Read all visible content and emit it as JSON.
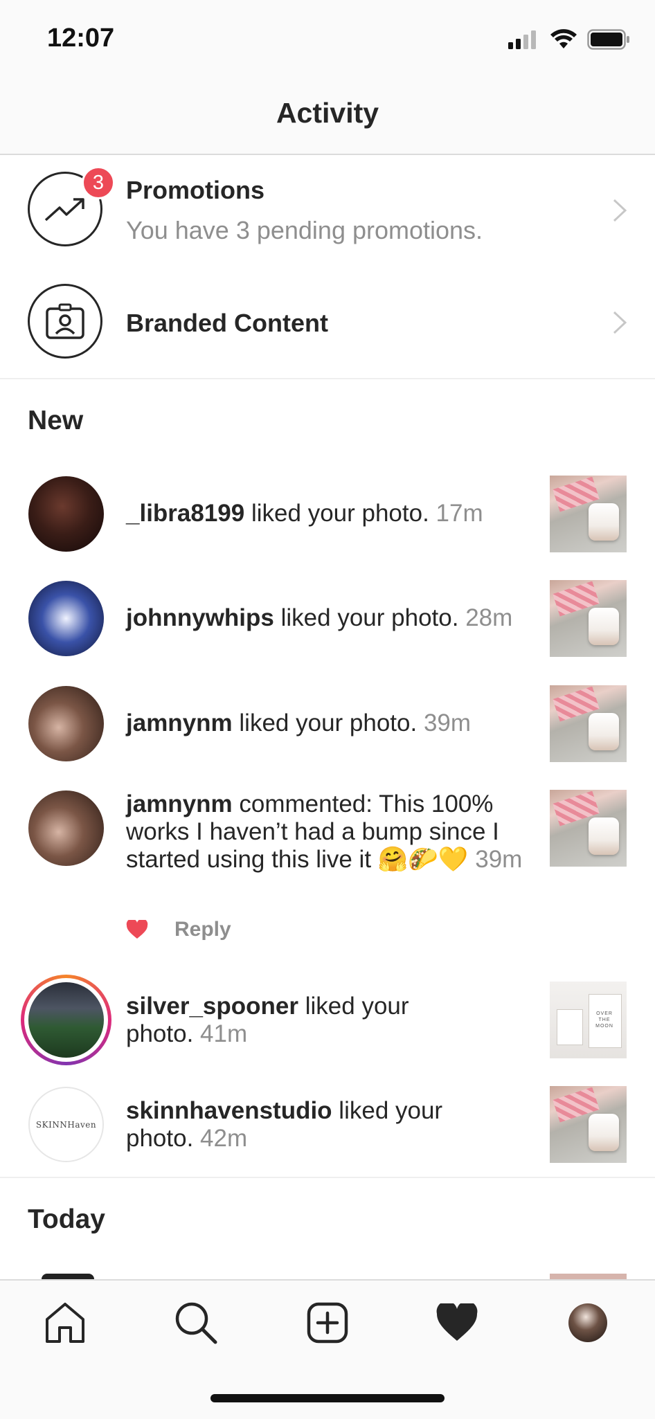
{
  "status_bar": {
    "time": "12:07",
    "icons": [
      "signal-icon",
      "wifi-icon",
      "battery-icon"
    ]
  },
  "header": {
    "title": "Activity"
  },
  "promotions": {
    "title": "Promotions",
    "subtitle": "You have 3 pending promotions.",
    "badge": "3"
  },
  "branded_content": {
    "title": "Branded Content"
  },
  "sections": {
    "new": "New",
    "today": "Today"
  },
  "activity": [
    {
      "user": "_libra8199",
      "text": "liked your photo.",
      "time": "17m"
    },
    {
      "user": "johnnywhips",
      "text": "liked your photo.",
      "time": "28m"
    },
    {
      "user": "jamnynm",
      "text": "liked your photo.",
      "time": "39m"
    },
    {
      "user": "jamnynm",
      "text": "commented: This 100% works I haven’t had a bump since I started using this live it 🤗🌮💛",
      "time": "39m",
      "reply": "Reply"
    },
    {
      "user": "silver_spooner",
      "text": "liked your photo.",
      "time": "41m"
    },
    {
      "user": "skinnhavenstudio",
      "text": "liked your photo.",
      "time": "42m"
    }
  ],
  "skinn_logo": "SKINNHaven",
  "thumb_text": "OVER THE MOON",
  "tabs": [
    "home-icon",
    "search-icon",
    "add-post-icon",
    "heart-icon",
    "profile-avatar"
  ]
}
